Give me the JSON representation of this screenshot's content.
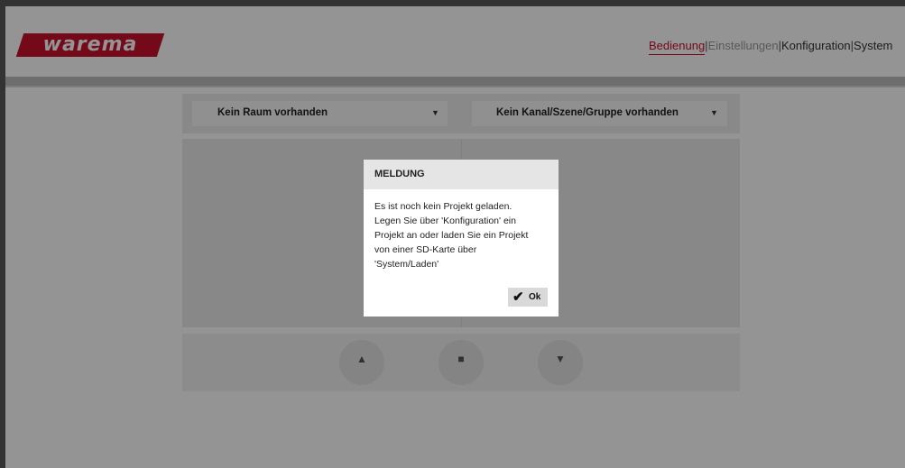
{
  "brand": {
    "logo_text": "warema",
    "color": "#c8102e"
  },
  "nav": {
    "items": [
      {
        "label": "Bedienung",
        "active": true
      },
      {
        "label": "Einstellungen",
        "active": false
      },
      {
        "label": "Konfiguration",
        "active": false
      },
      {
        "label": "System",
        "active": false
      }
    ],
    "separator": "|"
  },
  "selectors": {
    "room": {
      "value": "Kein Raum vorhanden"
    },
    "channel": {
      "value": "Kein Kanal/Szene/Gruppe vorhanden"
    }
  },
  "controls": {
    "up_icon": "triangle-up-icon",
    "stop_icon": "square-stop-icon",
    "down_icon": "triangle-down-icon"
  },
  "dialog": {
    "title": "MELDUNG",
    "message_lines": [
      "Es ist noch kein Projekt geladen.",
      "Legen Sie über 'Konfiguration' ein",
      "Projekt an oder laden Sie ein Projekt",
      "von einer SD-Karte über",
      "'System/Laden'"
    ],
    "ok_label": "Ok",
    "ok_icon": "checkmark-icon"
  }
}
